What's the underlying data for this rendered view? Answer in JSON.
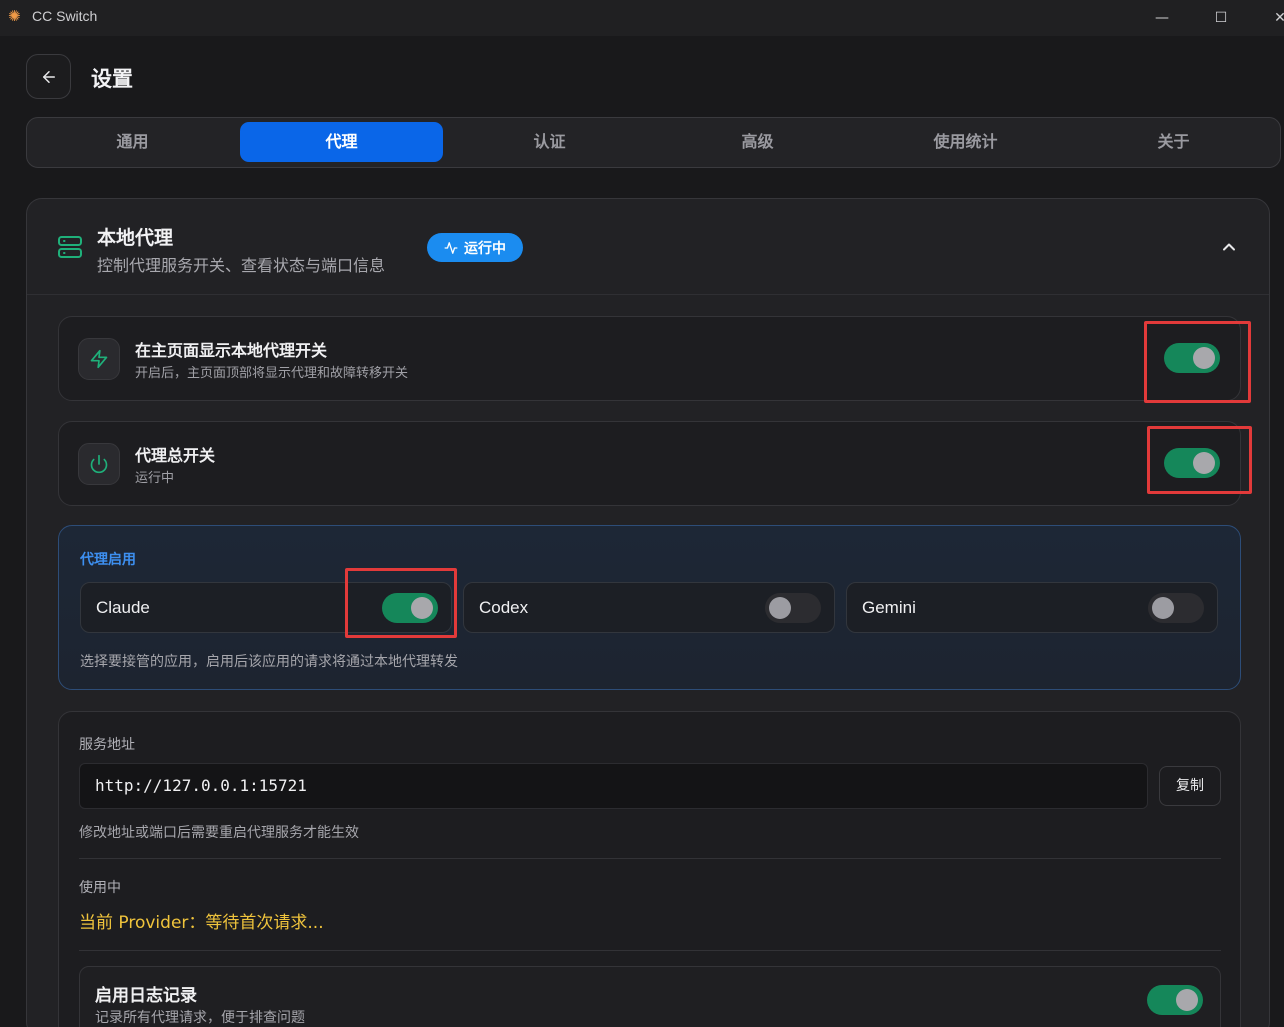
{
  "window": {
    "title": "CC Switch",
    "minimize": "—",
    "maximize": "☐",
    "close": "✕"
  },
  "header": {
    "title": "设置"
  },
  "tabs": [
    {
      "label": "通用"
    },
    {
      "label": "代理",
      "active": true
    },
    {
      "label": "认证"
    },
    {
      "label": "高级"
    },
    {
      "label": "使用统计"
    },
    {
      "label": "关于"
    }
  ],
  "local_proxy": {
    "title": "本地代理",
    "subtitle": "控制代理服务开关、查看状态与端口信息",
    "status_badge": "运行中",
    "settings": [
      {
        "title": "在主页面显示本地代理开关",
        "subtitle": "开启后，主页面顶部将显示代理和故障转移开关",
        "enabled": true
      },
      {
        "title": "代理总开关",
        "subtitle": "运行中",
        "enabled": true
      }
    ],
    "apps": {
      "label": "代理启用",
      "items": [
        {
          "name": "Claude",
          "enabled": true
        },
        {
          "name": "Codex",
          "enabled": false
        },
        {
          "name": "Gemini",
          "enabled": false
        }
      ],
      "hint": "选择要接管的应用，启用后该应用的请求将通过本地代理转发"
    },
    "server": {
      "label": "服务地址",
      "address": "http://127.0.0.1:15721",
      "copy_label": "复制",
      "hint": "修改地址或端口后需要重启代理服务才能生效",
      "in_use_label": "使用中",
      "current_provider": "当前 Provider：等待首次请求..."
    },
    "logging": {
      "title": "启用日志记录",
      "subtitle": "记录所有代理请求，便于排查问题",
      "enabled": true
    }
  },
  "colors": {
    "accent": "#0a66e8",
    "toggle_on": "#15875a",
    "highlight": "#e23a3a",
    "provider_text": "#f0c43c"
  }
}
